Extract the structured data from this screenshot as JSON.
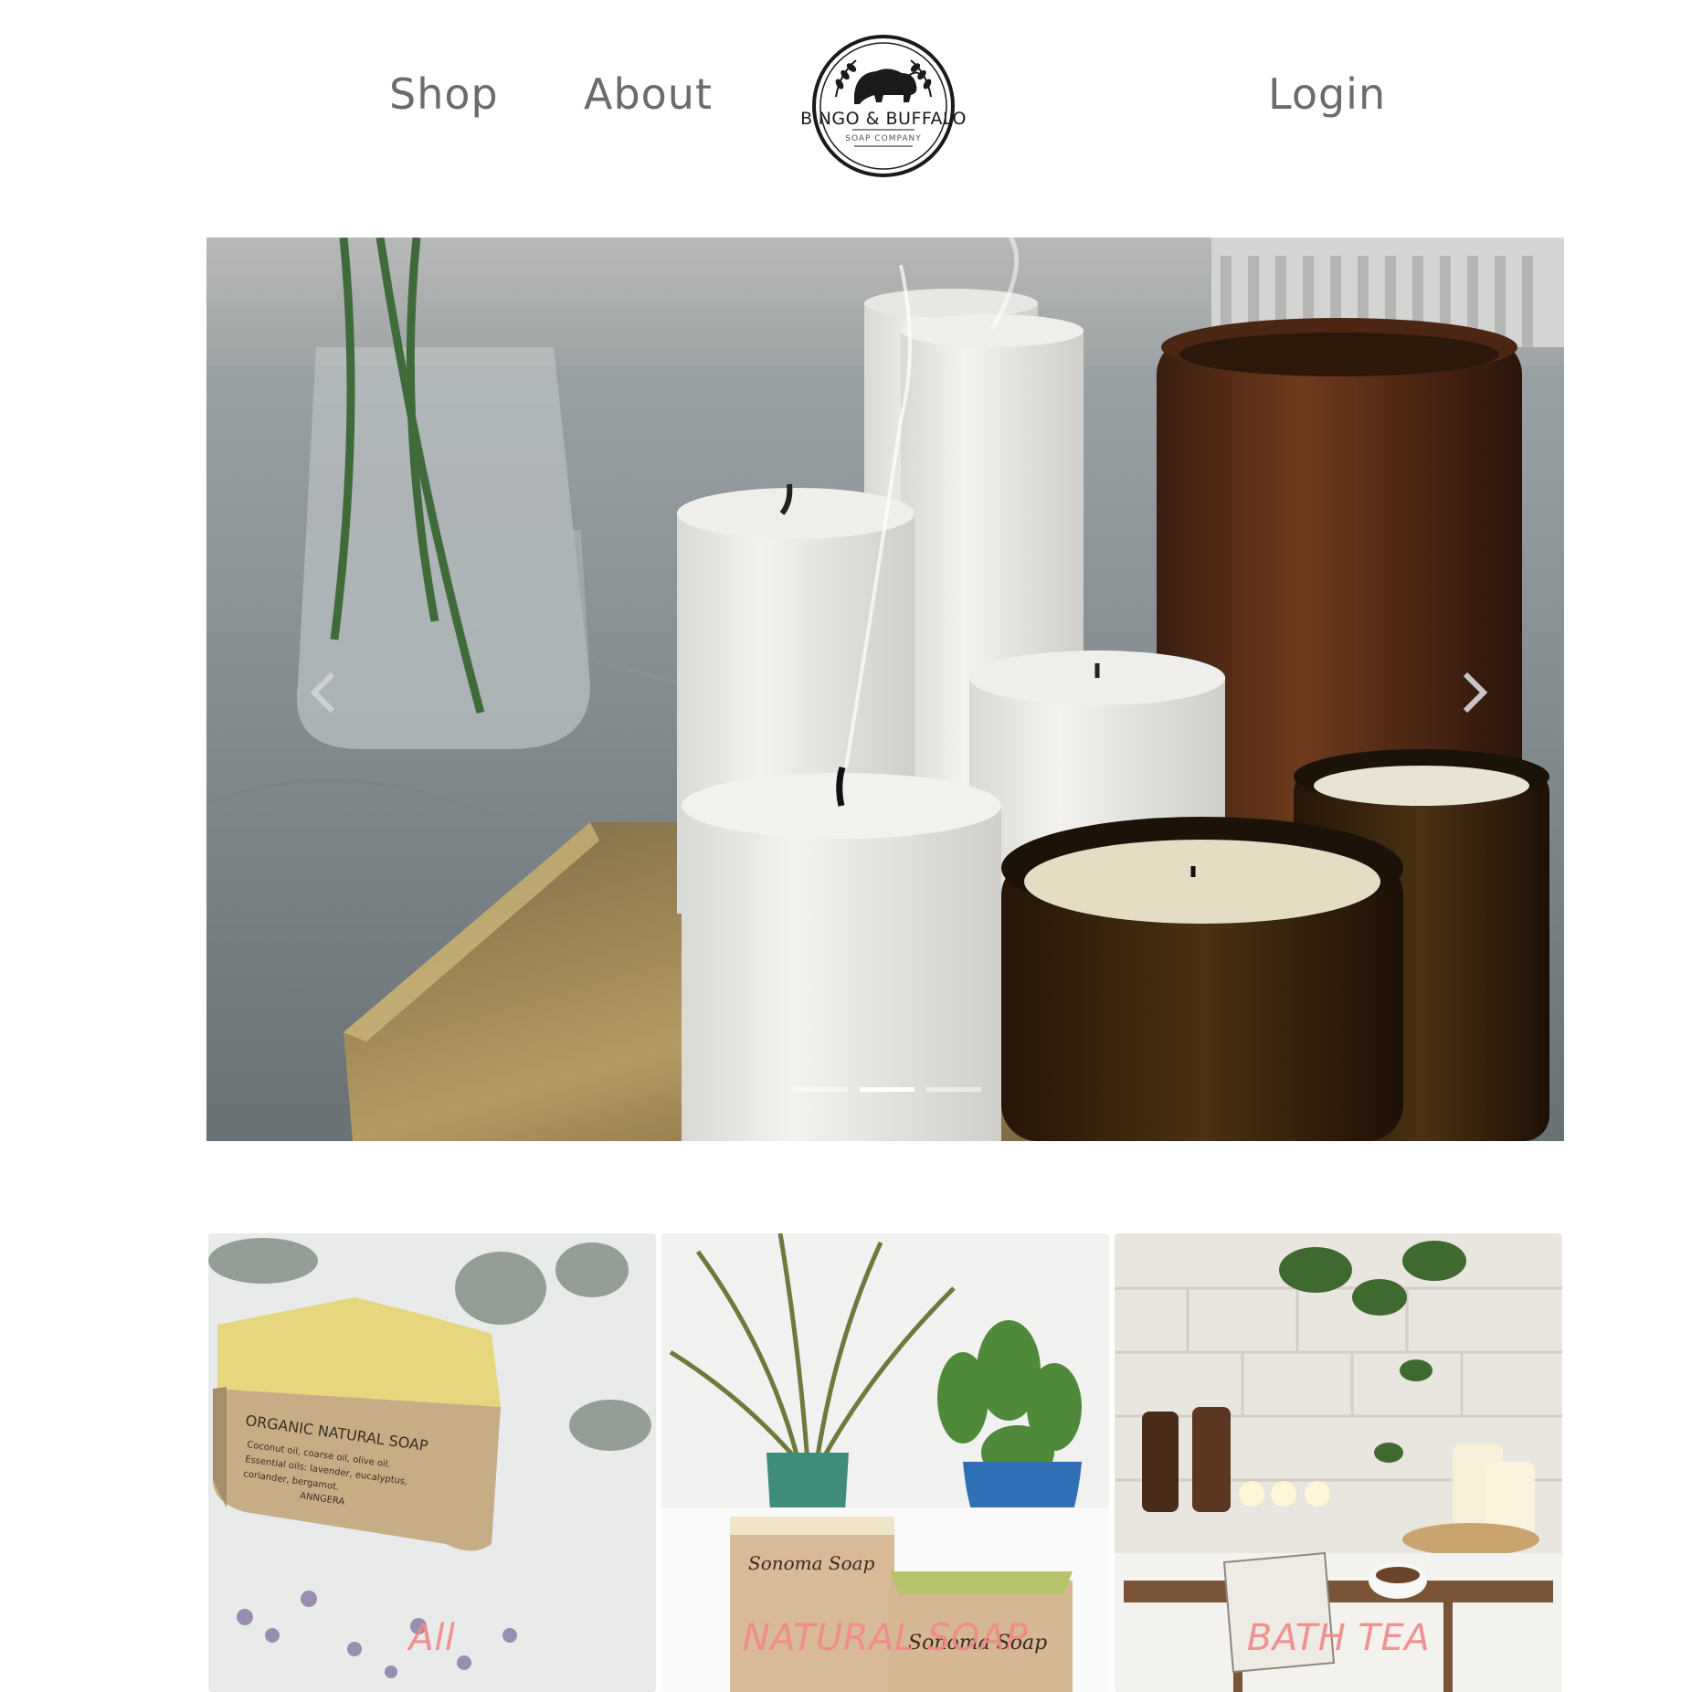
{
  "nav": {
    "shop_label": "Shop",
    "about_label": "About",
    "login_label": "Login"
  },
  "logo": {
    "brand_name": "BINGO & BUFFALO",
    "tagline": "SOAP COMPANY"
  },
  "carousel": {
    "slide_count": 3,
    "active_slide": 2,
    "prev_icon": "chevron-left-icon",
    "next_icon": "chevron-right-icon"
  },
  "categories": [
    {
      "label": "All"
    },
    {
      "label": "NATURAL SOAP"
    },
    {
      "label": "BATH TEA"
    }
  ],
  "product_image_text": {
    "soap_label_title": "ORGANIC NATURAL SOAP",
    "soap_label_line1": "Coconut oil, coarse oil, olive oil.",
    "soap_label_line2": "Essential oils: lavender, eucalyptus,",
    "soap_label_line3": "coriander, bergamot.",
    "soap_label_brand": "ANNGERA",
    "sonoma_label": "Sonoma Soap"
  },
  "colors": {
    "nav_text": "#6b6b6b",
    "category_label": "#f08a8a",
    "background": "#ffffff"
  }
}
